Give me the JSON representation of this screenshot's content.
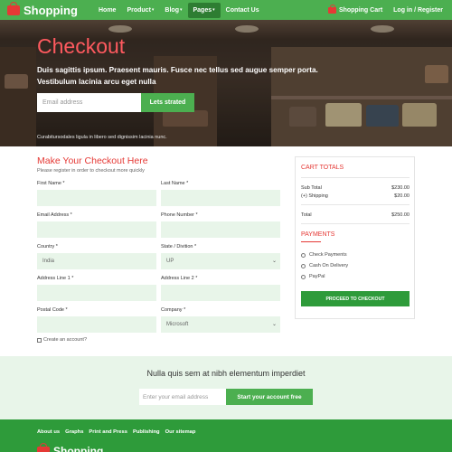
{
  "navbar": {
    "brand": "Shopping",
    "links": [
      {
        "label": "Home",
        "caret": ""
      },
      {
        "label": "Product",
        "caret": "▾"
      },
      {
        "label": "Blog",
        "caret": "▾"
      },
      {
        "label": "Pages",
        "caret": "▾"
      },
      {
        "label": "Contact Us",
        "caret": ""
      }
    ],
    "active_link": "Pages",
    "cart": "Shopping Cart",
    "login": "Log in / Register"
  },
  "hero": {
    "title": "Checkout",
    "subtitle": "Duis sagittis ipsum. Praesent mauris. Fusce nec tellus sed augue semper porta. Vestibulum lacinia arcu eget nulla",
    "email_placeholder": "Email address",
    "cta": "Lets strated",
    "note": "Curabitursodales ligula in libero sed dignissim lacinia nunc."
  },
  "checkout": {
    "title": "Make Your Checkout Here",
    "subtitle": "Please register in order to checkout more quickly",
    "fields": {
      "first_name": {
        "label": "First Name *",
        "value": ""
      },
      "last_name": {
        "label": "Last Name *",
        "value": ""
      },
      "email": {
        "label": "Email Address *",
        "value": ""
      },
      "phone": {
        "label": "Phone Number *",
        "value": ""
      },
      "country": {
        "label": "Country *",
        "value": "India"
      },
      "state": {
        "label": "State / Divition *",
        "value": "UP"
      },
      "address1": {
        "label": "Address Line 1 *",
        "value": ""
      },
      "address2": {
        "label": "Address Line 2 *",
        "value": ""
      },
      "postal": {
        "label": "Postal Code *",
        "value": ""
      },
      "company": {
        "label": "Company *",
        "value": "Microsoft"
      }
    },
    "create_account": "Create an account?"
  },
  "cart_totals": {
    "title": "CART TOTALS",
    "rows": [
      {
        "label": "Sub Total",
        "value": "$230.00"
      },
      {
        "label": "(+) Shipping",
        "value": "$20.00"
      }
    ],
    "total_label": "Total",
    "total_value": "$250.00",
    "payments_title": "PAYMENTS",
    "payment_options": [
      "Check Payments",
      "Cash On Delivery",
      "PayPal"
    ],
    "proceed": "PROCEED TO CHECKOUT"
  },
  "newsletter": {
    "title": "Nulla quis sem at nibh elementum imperdiet",
    "placeholder": "Enter your email address",
    "button": "Start your account free"
  },
  "footer": {
    "links": [
      "About us",
      "Graphs",
      "Print and Press",
      "Publishing",
      "Our sitemap"
    ],
    "brand": "Shopping"
  },
  "colors": {
    "brand_green": "#4caf50",
    "dark_green": "#2e9b3a",
    "accent_red": "#e53935",
    "input_bg": "#e8f5e9"
  }
}
